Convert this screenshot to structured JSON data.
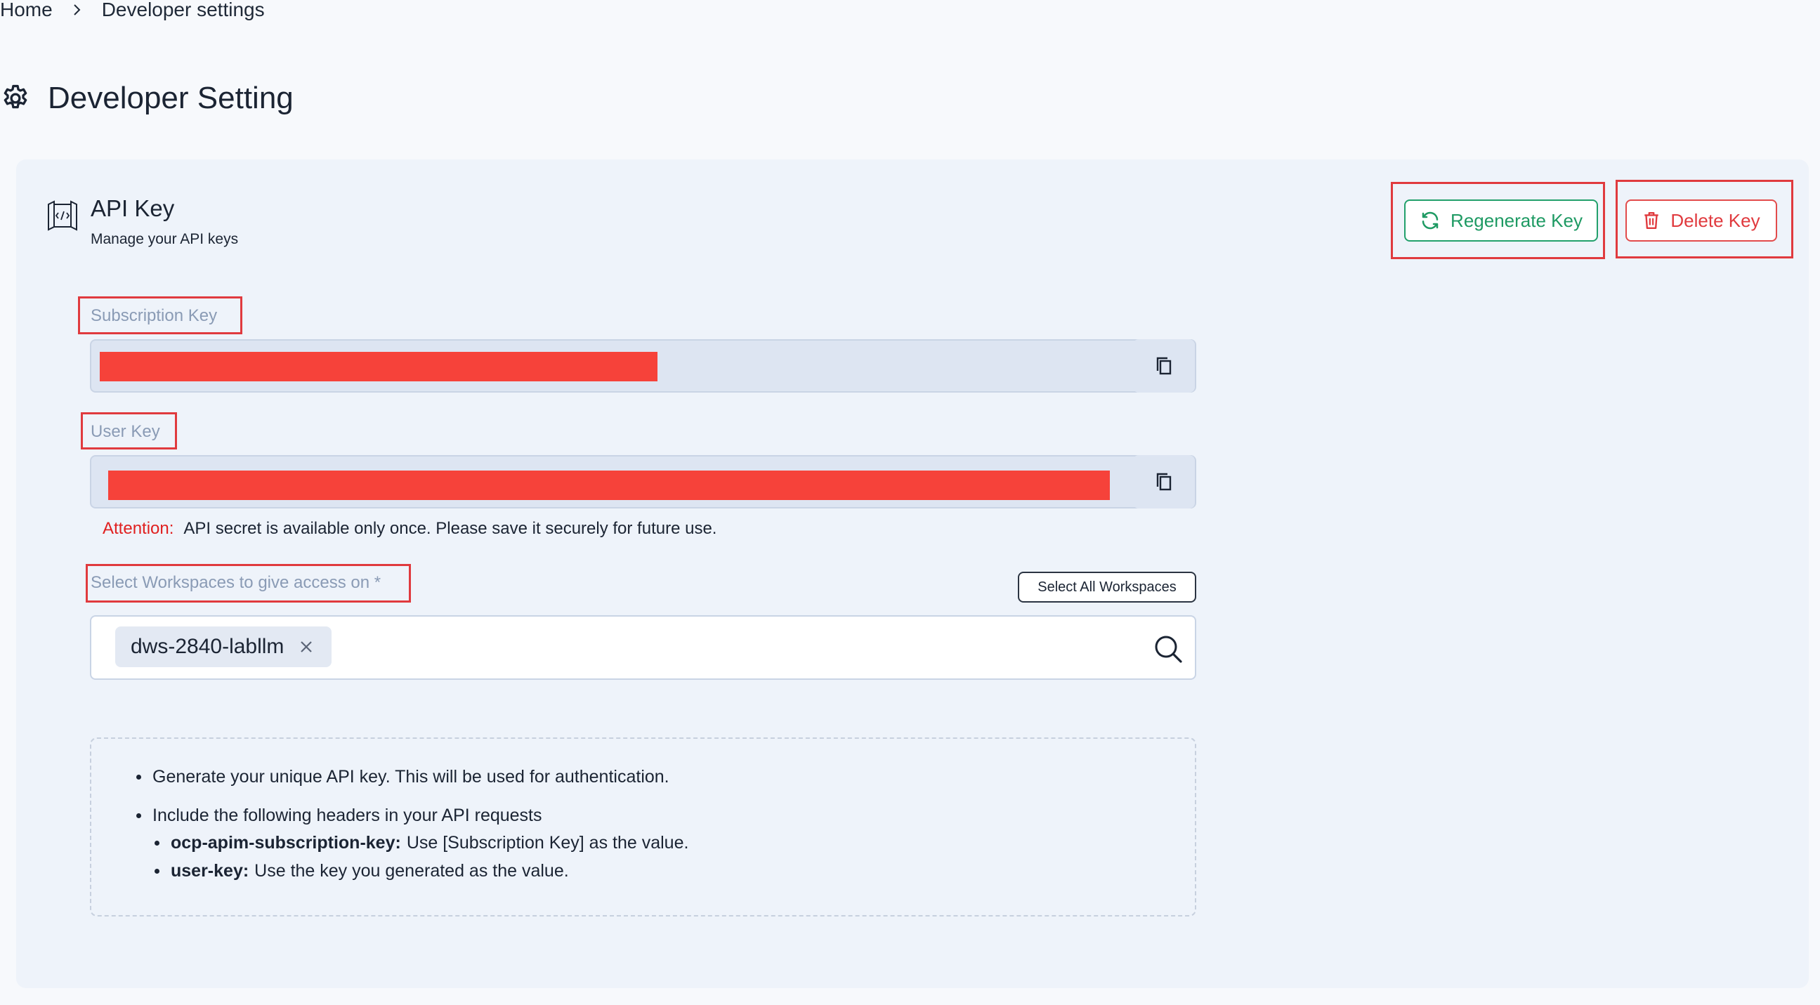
{
  "breadcrumb": {
    "home": "Home",
    "current": "Developer settings"
  },
  "page": {
    "title": "Developer Setting"
  },
  "card": {
    "title": "API Key",
    "subtitle": "Manage your API keys",
    "buttons": {
      "regenerate": "Regenerate Key",
      "delete": "Delete Key"
    }
  },
  "fields": {
    "subscription_key_label": "Subscription Key",
    "user_key_label": "User Key",
    "subscription_key_value": "",
    "user_key_value": ""
  },
  "attention": {
    "label": "Attention:",
    "message": "API secret is available only once. Please save it securely for future use."
  },
  "workspaces": {
    "label": "Select Workspaces to give access on *",
    "select_all": "Select All Workspaces",
    "selected": [
      "dws-2840-labllm"
    ]
  },
  "info": {
    "item1": "Generate your unique API key. This will be used for authentication.",
    "item2": "Include the following headers in your API requests",
    "sub1_key": "ocp-apim-subscription-key:",
    "sub1_text": "Use [Subscription Key] as the value.",
    "sub2_key": "user-key:",
    "sub2_text": "Use the key you generated as the value."
  },
  "colors": {
    "regenerate": "#1e9a63",
    "delete": "#e03a3e",
    "redaction": "#f6423a",
    "highlight_box": "#e03a3e",
    "attention": "#e02020"
  },
  "icons": {
    "breadcrumb_separator": "chevron-right-icon",
    "page_title": "gear-icon",
    "card_header": "api-book-icon",
    "regenerate": "refresh-icon",
    "delete": "trash-icon",
    "copy": "copy-icon",
    "chip_remove": "close-icon",
    "search": "search-icon"
  }
}
